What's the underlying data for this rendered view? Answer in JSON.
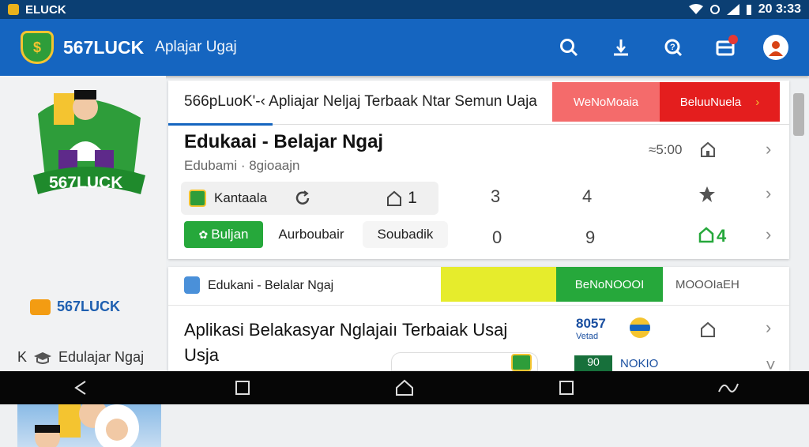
{
  "status_bar": {
    "app_name": "ELUCK",
    "time": "20 3:33",
    "icons": [
      "wifi-icon",
      "alarm-icon",
      "signal-icon",
      "battery-icon"
    ]
  },
  "app_bar": {
    "brand": "567LUCK",
    "subtitle": "Aplajar Ugaj",
    "actions": [
      "search-icon",
      "download-icon",
      "help-search-icon",
      "inbox-icon",
      "profile-avatar"
    ]
  },
  "sidebar": {
    "hero_badge": "567LUCK",
    "brand": "567LUCK",
    "nav_label": "Edulajar Ngaj",
    "nav_prefix": "K"
  },
  "card1": {
    "banner_text": "566pLuoK'-‹ Apliajar Neljaj Terbaak Ntar Semun Uaja",
    "banner_btn_1": "WeNoMoaia",
    "banner_btn_2": "BeluuNuela",
    "banner_chevron": "›",
    "title": "Edukaai - Belajar Ngaj",
    "subtitle": "Edubami · 8gioaajn",
    "meta_time": "≈5:00",
    "row1": {
      "chip_label": "Kantaala",
      "count_home": "1",
      "num_a": "3",
      "num_b": "4"
    },
    "row2": {
      "green_chip": "Buljan",
      "label_a": "Aurboubair",
      "label_b": "Soubadik",
      "num_a": "0",
      "num_b": "9",
      "count_green": "4"
    }
  },
  "card2": {
    "label": "Edukani - Belalar Ngaj",
    "btn_green": "BeNoNOOOI",
    "tab_gray": "MOOOIaEH",
    "title": "Aplikasi Belakasyar Nglajaiı Terbaiak Usaj Usja",
    "logo_main": "8057",
    "logo_small": "Vetad",
    "green_box": "90",
    "nokio": "NOKIO"
  },
  "colors": {
    "status_bar": "#0b3f73",
    "app_bar": "#1565c0",
    "banner_pink": "#f46b6b",
    "banner_red": "#e41e1e",
    "accent_green": "#26a83b",
    "accent_yellow": "#e6ec2c",
    "nav_bar": "#060606"
  }
}
